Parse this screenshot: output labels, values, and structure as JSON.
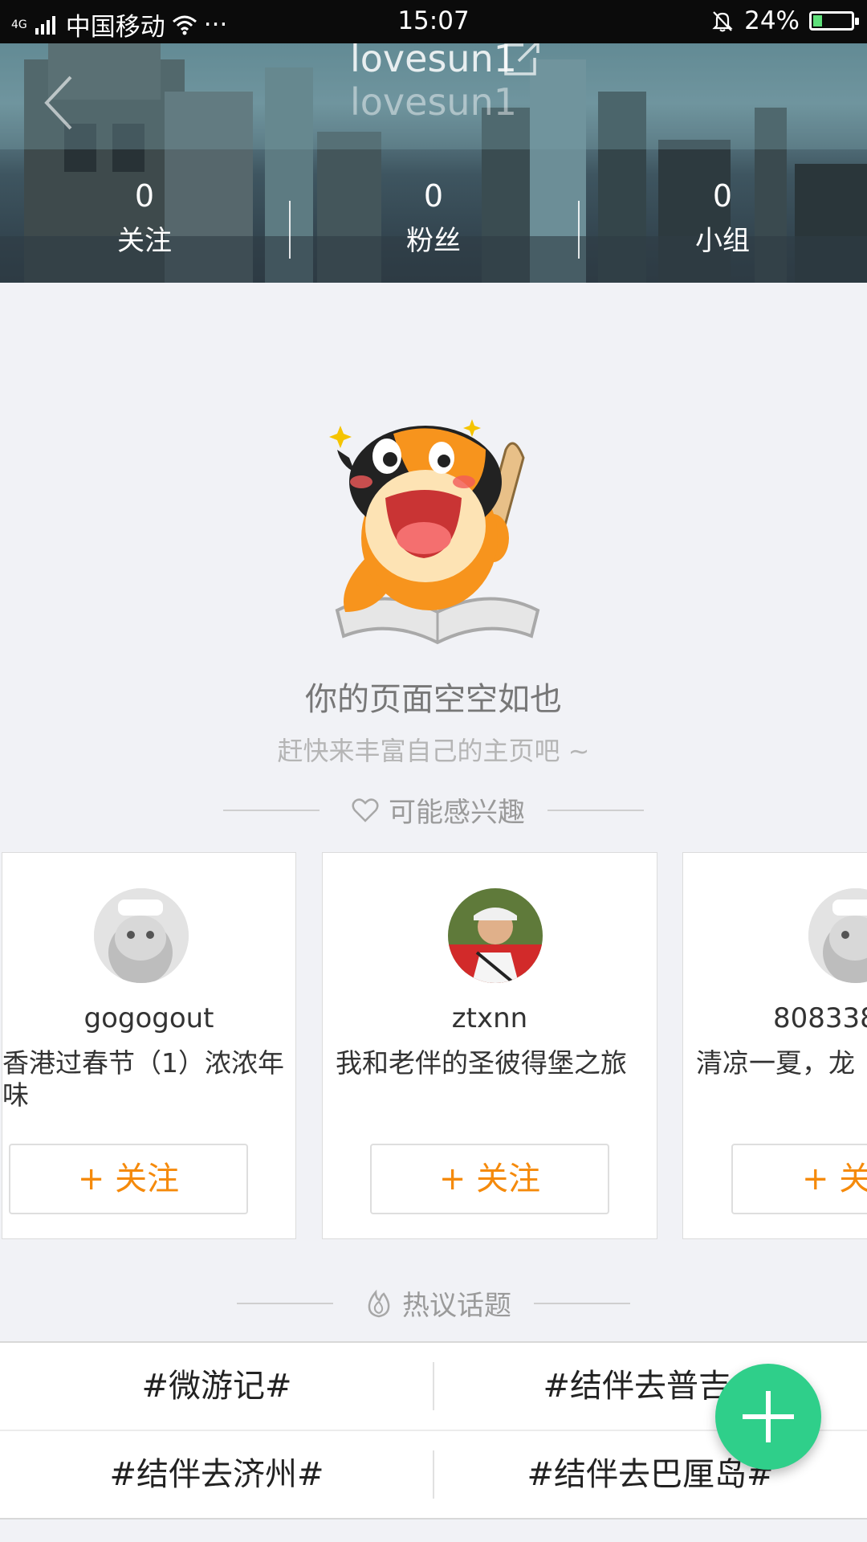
{
  "status_bar": {
    "network": "4G",
    "carrier": "中国移动",
    "more": "···",
    "time": "15:07",
    "battery": "24%",
    "battery_level": 0.24
  },
  "profile": {
    "username": "lovesun1",
    "username_sub": "lovesun1",
    "stats": [
      {
        "count": "0",
        "label": "关注"
      },
      {
        "count": "0",
        "label": "粉丝"
      },
      {
        "count": "0",
        "label": "小组"
      }
    ]
  },
  "empty_state": {
    "title": "你的页面空空如也",
    "subtitle": "赶快来丰富自己的主页吧 ~"
  },
  "interests": {
    "title": "可能感兴趣",
    "cards": [
      {
        "name": "gogogout",
        "desc": "香港过春节（1）浓浓年味",
        "follow": "+ 关注"
      },
      {
        "name": "ztxnn",
        "desc": "我和老伴的圣彼得堡之旅",
        "follow": "+ 关注"
      },
      {
        "name": "808338",
        "desc": "清凉一夏，龙",
        "follow": "+ 关"
      }
    ]
  },
  "hot_topics": {
    "title": "热议话题",
    "items": [
      "#微游记#",
      "#结伴去普吉#",
      "#结伴去济州#",
      "#结伴去巴厘岛#"
    ]
  },
  "colors": {
    "accent_orange": "#f58a0b",
    "fab_green": "#2fcf8a",
    "background": "#f1f2f6"
  }
}
